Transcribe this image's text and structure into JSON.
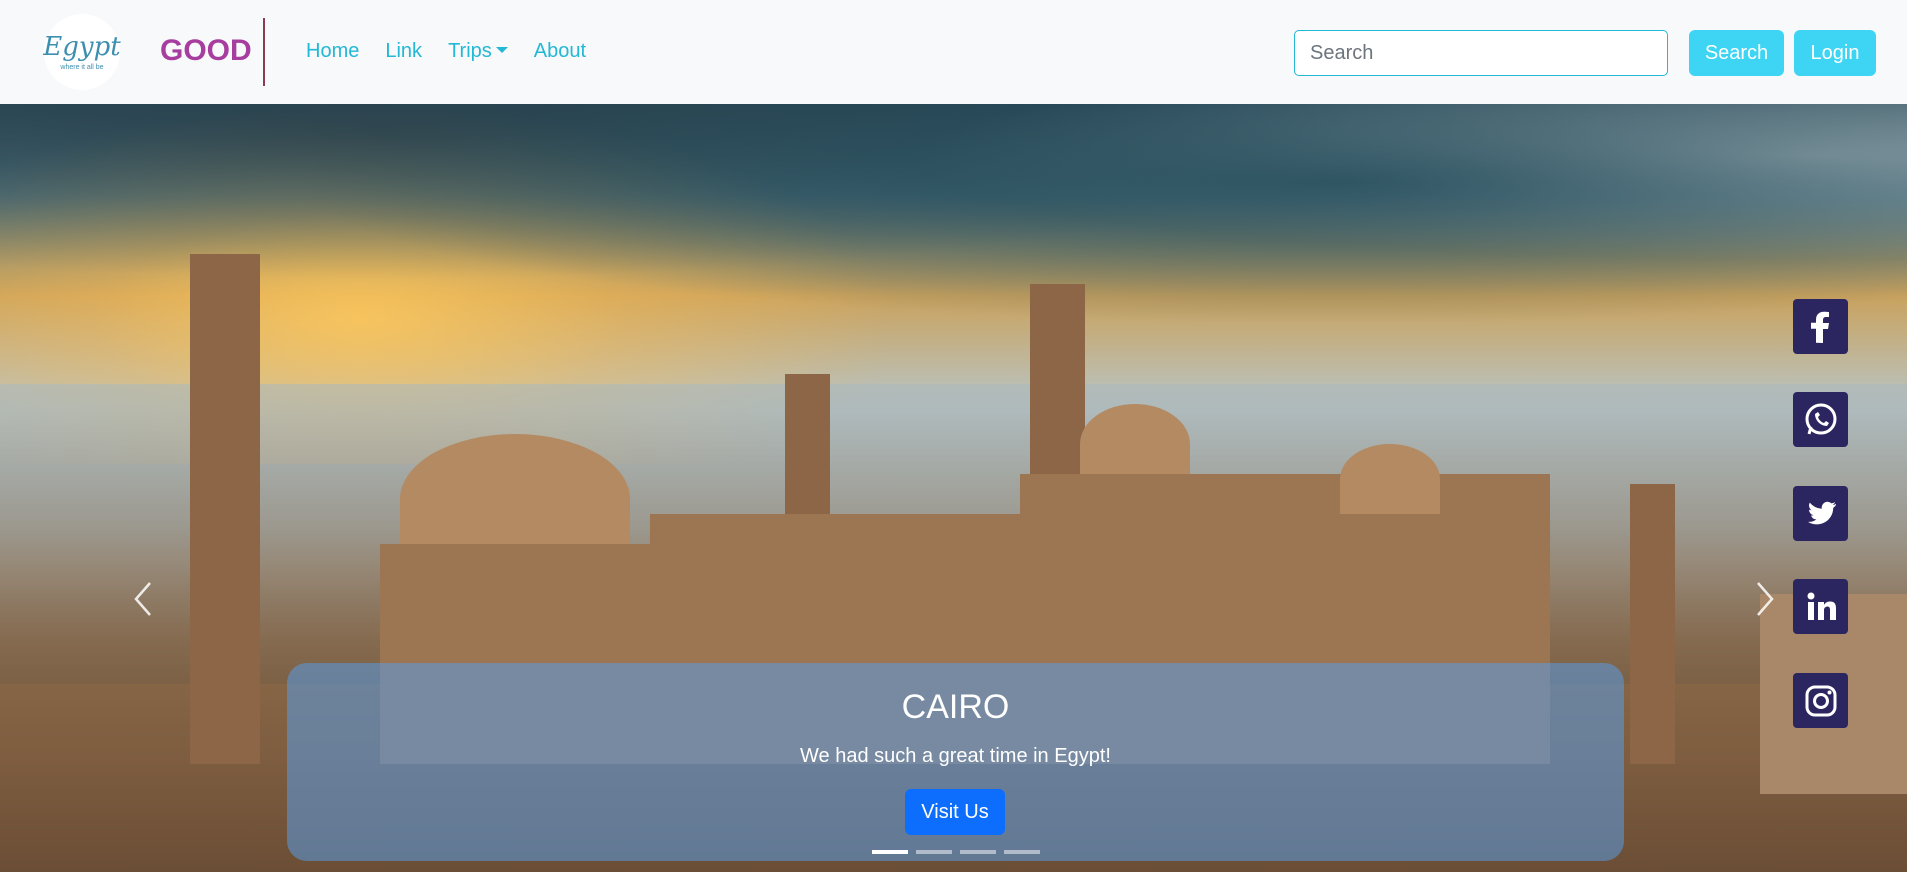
{
  "navbar": {
    "logo_text": "Egypt",
    "logo_subtext": "where it all be",
    "brand": "GOOD",
    "links": [
      {
        "label": "Home"
      },
      {
        "label": "Link"
      },
      {
        "label": "Trips"
      },
      {
        "label": "About"
      }
    ],
    "search_placeholder": "Search",
    "search_button": "Search",
    "login_button": "Login"
  },
  "hero": {
    "caption_title": "CAIRO",
    "caption_text": "We had such a great time in Egypt!",
    "caption_button": "Visit Us",
    "indicators": 4,
    "active_indicator": 0,
    "prev_icon": "chevron-left-icon",
    "next_icon": "chevron-right-icon"
  },
  "social": [
    {
      "icon": "facebook-icon"
    },
    {
      "icon": "whatsapp-icon"
    },
    {
      "icon": "twitter-icon"
    },
    {
      "icon": "linkedin-icon"
    },
    {
      "icon": "instagram-icon"
    }
  ],
  "colors": {
    "accent": "#3dd5f3",
    "brand": "#a63d9f",
    "link": "#22b8d6",
    "social_bg": "#2c2660",
    "caption_button": "#0d6efd"
  }
}
